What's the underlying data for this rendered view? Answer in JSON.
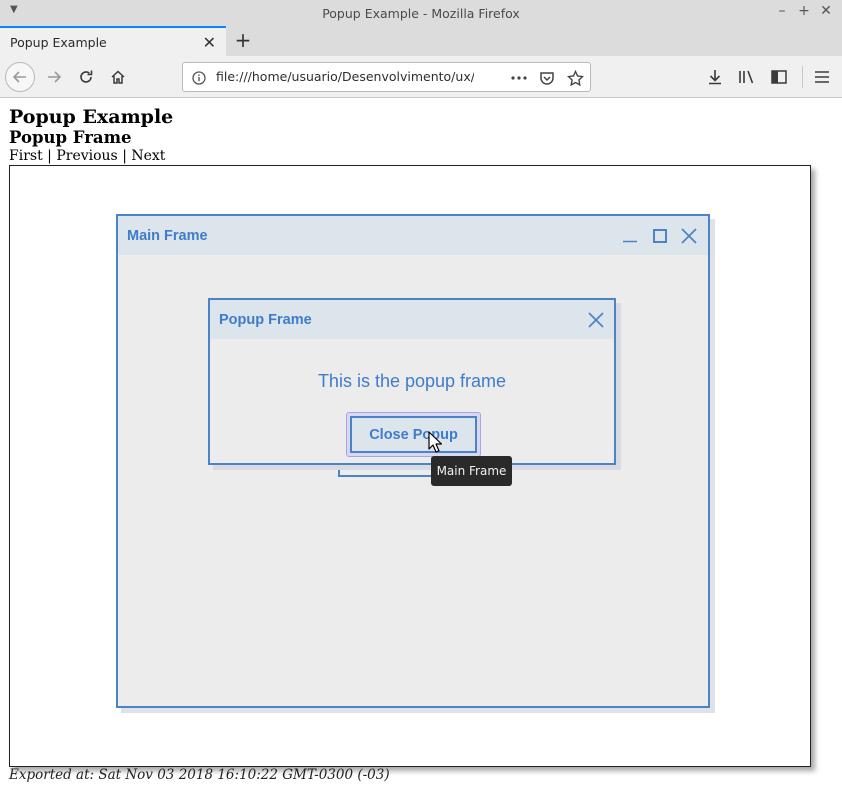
{
  "window": {
    "title": "Popup Example - Mozilla Firefox",
    "tab_label": "Popup Example"
  },
  "navbar": {
    "url": "file:///home/usuario/Desenvolvimento/ux/pend"
  },
  "page": {
    "heading": "Popup Example",
    "subheading": "Popup Frame",
    "pager": {
      "first": "First",
      "separator": "|",
      "previous": "Previous",
      "next": "Next"
    },
    "export_note": "Exported at: Sat Nov 03 2018 16:10:22 GMT-0300 (-03)"
  },
  "mock": {
    "main_frame_title": "Main Frame",
    "popup_frame_title": "Popup Frame",
    "popup_text": "This is the popup frame",
    "close_popup_label": "Close Popup",
    "tooltip": "Main Frame"
  },
  "colors": {
    "accent": "#3f7ccb",
    "frame_border": "#4a83c8",
    "header_bg": "#dce4ec",
    "frame_bg": "#ececec",
    "firefox_tab_accent": "#0a84ff"
  },
  "icons": {
    "window_menu": "chevron-down-icon",
    "back": "arrow-left-icon",
    "forward": "arrow-right-icon",
    "reload": "reload-icon",
    "home": "home-icon",
    "page_info": "info-icon",
    "page_actions": "more-icon",
    "pocket": "pocket-icon",
    "bookmark": "star-icon",
    "downloads": "download-icon",
    "library": "library-icon",
    "sidebar": "sidebar-icon",
    "menu": "hamburger-icon"
  }
}
